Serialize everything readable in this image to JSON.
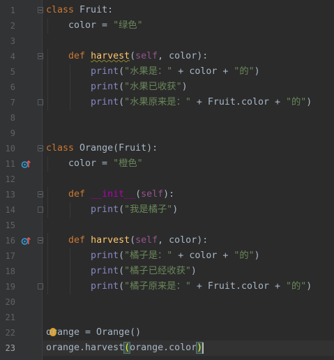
{
  "editor": {
    "language": "python",
    "current_line": 23,
    "lines": [
      {
        "n": "1",
        "tokens": [
          {
            "t": "class ",
            "c": "kw"
          },
          {
            "t": "Fruit:",
            "c": ""
          }
        ]
      },
      {
        "n": "2",
        "tokens": [
          {
            "t": "    color = ",
            "c": ""
          },
          {
            "t": "\"绿色\"",
            "c": "str"
          }
        ]
      },
      {
        "n": "3",
        "tokens": []
      },
      {
        "n": "4",
        "tokens": [
          {
            "t": "    ",
            "c": ""
          },
          {
            "t": "def ",
            "c": "kw"
          },
          {
            "t": "harvest",
            "c": "fn warn"
          },
          {
            "t": "(",
            "c": ""
          },
          {
            "t": "self",
            "c": "slf"
          },
          {
            "t": ", color):",
            "c": ""
          }
        ]
      },
      {
        "n": "5",
        "tokens": [
          {
            "t": "        ",
            "c": ""
          },
          {
            "t": "print",
            "c": "bi"
          },
          {
            "t": "(",
            "c": ""
          },
          {
            "t": "\"水果是：\"",
            "c": "str"
          },
          {
            "t": " + color + ",
            "c": ""
          },
          {
            "t": "\"的\"",
            "c": "str"
          },
          {
            "t": ")",
            "c": ""
          }
        ]
      },
      {
        "n": "6",
        "tokens": [
          {
            "t": "        ",
            "c": ""
          },
          {
            "t": "print",
            "c": "bi"
          },
          {
            "t": "(",
            "c": ""
          },
          {
            "t": "\"水果已收获\"",
            "c": "str"
          },
          {
            "t": ")",
            "c": ""
          }
        ]
      },
      {
        "n": "7",
        "tokens": [
          {
            "t": "        ",
            "c": ""
          },
          {
            "t": "print",
            "c": "bi"
          },
          {
            "t": "(",
            "c": ""
          },
          {
            "t": "\"水果原来是：\"",
            "c": "str"
          },
          {
            "t": " + Fruit.color + ",
            "c": ""
          },
          {
            "t": "\"的\"",
            "c": "str"
          },
          {
            "t": ")",
            "c": ""
          }
        ]
      },
      {
        "n": "8",
        "tokens": []
      },
      {
        "n": "9",
        "tokens": []
      },
      {
        "n": "10",
        "tokens": [
          {
            "t": "class ",
            "c": "kw"
          },
          {
            "t": "Orange(Fruit):",
            "c": ""
          }
        ]
      },
      {
        "n": "11",
        "tokens": [
          {
            "t": "    color = ",
            "c": ""
          },
          {
            "t": "\"橙色\"",
            "c": "str"
          }
        ]
      },
      {
        "n": "12",
        "tokens": []
      },
      {
        "n": "13",
        "tokens": [
          {
            "t": "    ",
            "c": ""
          },
          {
            "t": "def ",
            "c": "kw"
          },
          {
            "t": "__init__",
            "c": "magic"
          },
          {
            "t": "(",
            "c": ""
          },
          {
            "t": "self",
            "c": "slf"
          },
          {
            "t": "):",
            "c": ""
          }
        ]
      },
      {
        "n": "14",
        "tokens": [
          {
            "t": "        ",
            "c": ""
          },
          {
            "t": "print",
            "c": "bi"
          },
          {
            "t": "(",
            "c": ""
          },
          {
            "t": "\"我是橘子\"",
            "c": "str"
          },
          {
            "t": ")",
            "c": ""
          }
        ]
      },
      {
        "n": "15",
        "tokens": []
      },
      {
        "n": "16",
        "tokens": [
          {
            "t": "    ",
            "c": ""
          },
          {
            "t": "def ",
            "c": "kw"
          },
          {
            "t": "harvest",
            "c": "fn"
          },
          {
            "t": "(",
            "c": ""
          },
          {
            "t": "self",
            "c": "slf"
          },
          {
            "t": ", color):",
            "c": ""
          }
        ]
      },
      {
        "n": "17",
        "tokens": [
          {
            "t": "        ",
            "c": ""
          },
          {
            "t": "print",
            "c": "bi"
          },
          {
            "t": "(",
            "c": ""
          },
          {
            "t": "\"橘子是：\"",
            "c": "str"
          },
          {
            "t": " + color + ",
            "c": ""
          },
          {
            "t": "\"的\"",
            "c": "str"
          },
          {
            "t": ")",
            "c": ""
          }
        ]
      },
      {
        "n": "18",
        "tokens": [
          {
            "t": "        ",
            "c": ""
          },
          {
            "t": "print",
            "c": "bi"
          },
          {
            "t": "(",
            "c": ""
          },
          {
            "t": "\"橘子已经收获\"",
            "c": "str"
          },
          {
            "t": ")",
            "c": ""
          }
        ]
      },
      {
        "n": "19",
        "tokens": [
          {
            "t": "        ",
            "c": ""
          },
          {
            "t": "print",
            "c": "bi"
          },
          {
            "t": "(",
            "c": ""
          },
          {
            "t": "\"橘子原来是：\"",
            "c": "str"
          },
          {
            "t": " + Fruit.color + ",
            "c": ""
          },
          {
            "t": "\"的\"",
            "c": "str"
          },
          {
            "t": ")",
            "c": ""
          }
        ]
      },
      {
        "n": "20",
        "tokens": []
      },
      {
        "n": "21",
        "tokens": []
      },
      {
        "n": "22",
        "tokens": [
          {
            "t": "orange = Orange()",
            "c": ""
          }
        ]
      },
      {
        "n": "23",
        "tokens": [
          {
            "t": "orange.harvest",
            "c": ""
          },
          {
            "t": "(",
            "c": "brace"
          },
          {
            "t": "orange.color",
            "c": ""
          },
          {
            "t": ")",
            "c": "brace"
          }
        ]
      }
    ],
    "fold_markers": {
      "1": "start",
      "4": "start",
      "7": "end",
      "10": "start",
      "13": "start",
      "14": "end",
      "16": "start",
      "19": "end"
    },
    "override_icons": [
      "11",
      "16"
    ],
    "intention_bulb_line": "22",
    "colors": {
      "background": "#2b2b2b",
      "keyword": "#cc7832",
      "string": "#6a8759",
      "function": "#ffc66d",
      "self": "#94558d",
      "builtin": "#8888c6",
      "default_text": "#a9b7c6"
    }
  }
}
